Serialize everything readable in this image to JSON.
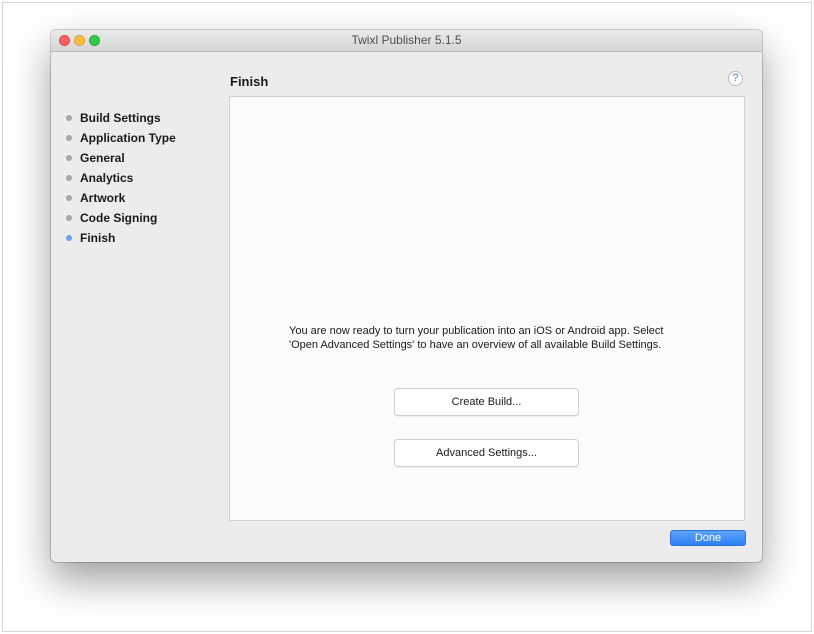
{
  "window": {
    "title": "Twixl Publisher 5.1.5"
  },
  "sidebar": {
    "items": [
      {
        "label": "Build Settings",
        "active": false
      },
      {
        "label": "Application Type",
        "active": false
      },
      {
        "label": "General",
        "active": false
      },
      {
        "label": "Analytics",
        "active": false
      },
      {
        "label": "Artwork",
        "active": false
      },
      {
        "label": "Code Signing",
        "active": false
      },
      {
        "label": "Finish",
        "active": true
      }
    ]
  },
  "main": {
    "title": "Finish",
    "help_label": "?",
    "message_line1": "You are now ready to turn your publication into an iOS or Android app. Select",
    "message_line2": "'Open Advanced Settings' to have an overview of all available Build Settings.",
    "create_build_label": "Create Build...",
    "advanced_settings_label": "Advanced Settings..."
  },
  "footer": {
    "done_label": "Done"
  },
  "colors": {
    "accent": "#2d7ff5",
    "active_step_dot": "#6aa3ef",
    "inactive_step_dot": "#a6a6a6",
    "close": "#fc605c",
    "minimize": "#fdbc40",
    "zoom": "#34c84a"
  }
}
